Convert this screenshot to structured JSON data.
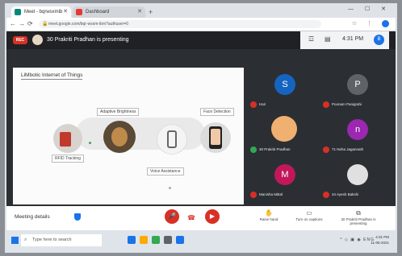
{
  "browser": {
    "tabs": [
      {
        "label": "Meet - bqrwsxmib",
        "active": true,
        "favicon_color": "#00897b"
      },
      {
        "label": "Dashboard",
        "active": false,
        "favicon_color": "#e53935"
      }
    ],
    "new_tab": "+",
    "window_controls": "— ☐ ✕",
    "url": "meet.google.com/bqr-wsxm-ibm?authuser=0",
    "nav": {
      "back": "←",
      "forward": "→",
      "reload": "⟳"
    },
    "addr_icons": "☆ ⋮"
  },
  "meet": {
    "rec_label": "REC",
    "presenting_text": "30 Prakriti Pradhan is presenting",
    "time": "4:31 PM",
    "user_initial": "B",
    "top_icons": {
      "people": "☲",
      "chat": "▤"
    }
  },
  "slide": {
    "title": "LiMbotic Internet of Things",
    "captions": {
      "adaptive": "Adaptive Brightness",
      "face": "Face Detection",
      "rfid": "RFID Tracking",
      "voice": "Voice Assistance"
    }
  },
  "participants": [
    {
      "initial": "S",
      "name": "Hari",
      "color": "#1565c0"
    },
    {
      "initial": "P",
      "name": "Poonam Panigrahi",
      "color": "#5f6368"
    },
    {
      "initial": "",
      "name": "30 Prakriti Pradhan",
      "color": "#f0b070"
    },
    {
      "initial": "n",
      "name": "71 Neha Jagannath",
      "color": "#9c27b0"
    },
    {
      "initial": "M",
      "name": "Manisha Mittal",
      "color": "#c2185b"
    },
    {
      "initial": "",
      "name": "34 Ayesh Bakshi",
      "color": "#e0e0e0"
    }
  ],
  "bottom": {
    "meeting_details": "Meeting details",
    "raise_hand": "Raise hand",
    "turn_on_captions": "Turn on captions",
    "presenting": "30 Prakriti Pradhan is presenting",
    "mic_icon": "🎤",
    "hangup_icon": "☎",
    "cam_icon": "▶"
  },
  "taskbar": {
    "search_placeholder": "Type here to search",
    "time": "4:31 PM",
    "date": "11-06-2021",
    "icons": [
      {
        "color": "#1a73e8"
      },
      {
        "color": "#f9ab00"
      },
      {
        "color": "#34a853"
      },
      {
        "color": "#5f6368"
      },
      {
        "color": "#1a73e8"
      }
    ],
    "tray": "^ ◇ ▣ ◉ ENG"
  }
}
